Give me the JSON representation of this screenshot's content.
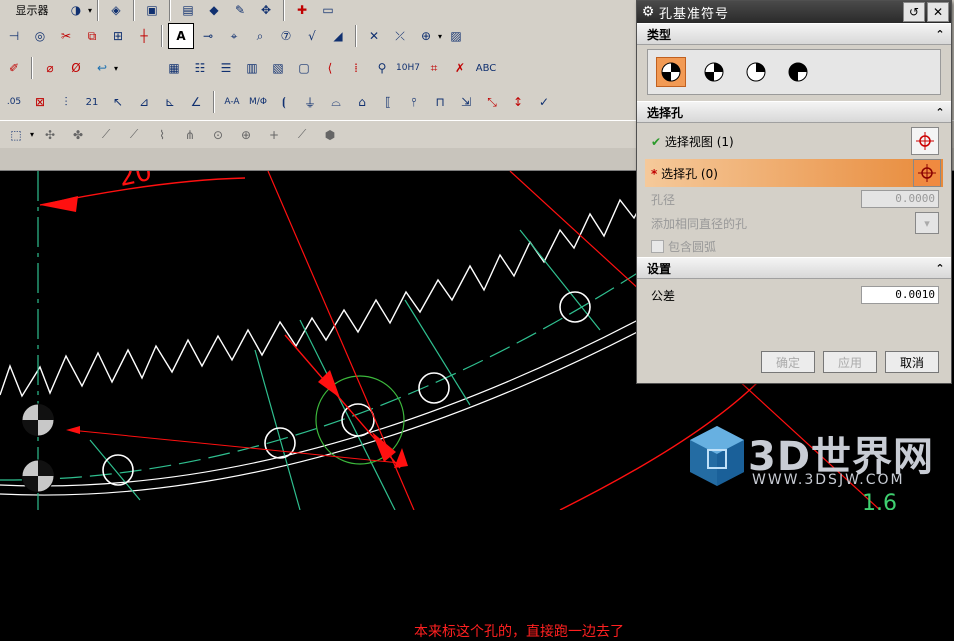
{
  "dialog": {
    "title": "孔基准符号",
    "sections": {
      "type": "类型",
      "select_hole": "选择孔",
      "settings": "设置"
    },
    "select_view": {
      "label": "选择视图 (1)",
      "status": "✔"
    },
    "select_hole": {
      "label": "选择孔 (0)",
      "status": "*"
    },
    "hole_diameter": {
      "label": "孔径",
      "value": "0.0000"
    },
    "add_same_diameter": {
      "label": "添加相同直径的孔"
    },
    "include_arc": {
      "label": "包含圆弧"
    },
    "tolerance": {
      "label": "公差",
      "value": "0.0010"
    },
    "buttons": {
      "ok": "确定",
      "apply": "应用",
      "cancel": "取消"
    }
  },
  "toolbar": {
    "partial_label": "显示器",
    "row2_text_tool": "A",
    "row3_text": "ABC",
    "row4_labels": [
      "A-A",
      "M/Φ",
      "10H7",
      "21"
    ]
  },
  "canvas": {
    "annotation": "本来标这个孔的，直接跑一边去了",
    "dimension_text": "20",
    "corner_text": "1.6"
  },
  "watermark": {
    "brand": "3D世界网",
    "url": "WWW.3DSJW.COM"
  },
  "colors": {
    "accent_orange": "#e88a3a",
    "dialog_bg": "#d4d0c8",
    "gear_line": "#ffffff",
    "center_line": "#2fbf8f",
    "dimension_red": "#ff1010"
  }
}
